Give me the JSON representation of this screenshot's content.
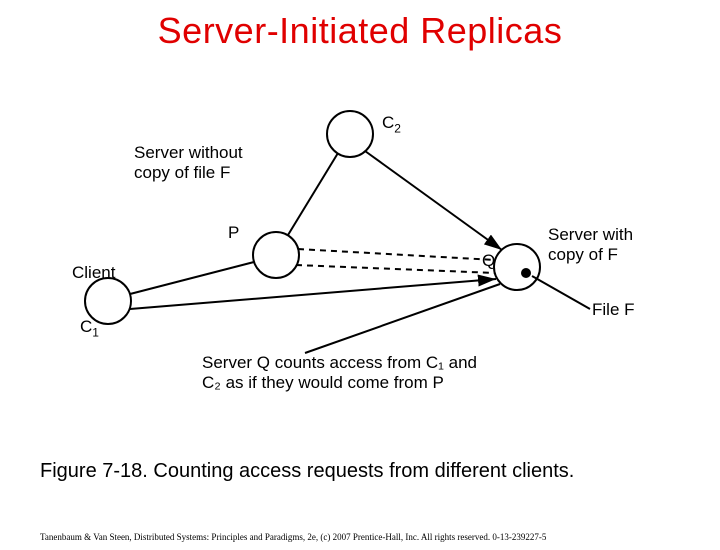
{
  "title": "Server-Initiated Replicas",
  "labels": {
    "c2": "C",
    "c2_sub": "2",
    "server_without": "Server without\ncopy of file F",
    "p": "P",
    "client": "Client",
    "c1": "C",
    "c1_sub": "1",
    "q": "Q",
    "server_with": "Server with\ncopy of F",
    "file_f": "File F",
    "count_note": "Server Q counts access from C₁ and\nC₂ as if they would come from P"
  },
  "caption": "Figure 7-18. Counting access requests from different clients.",
  "footer": "Tanenbaum & Van Steen, Distributed Systems: Principles and Paradigms, 2e, (c) 2007 Prentice-Hall, Inc. All rights reserved. 0-13-239227-5"
}
